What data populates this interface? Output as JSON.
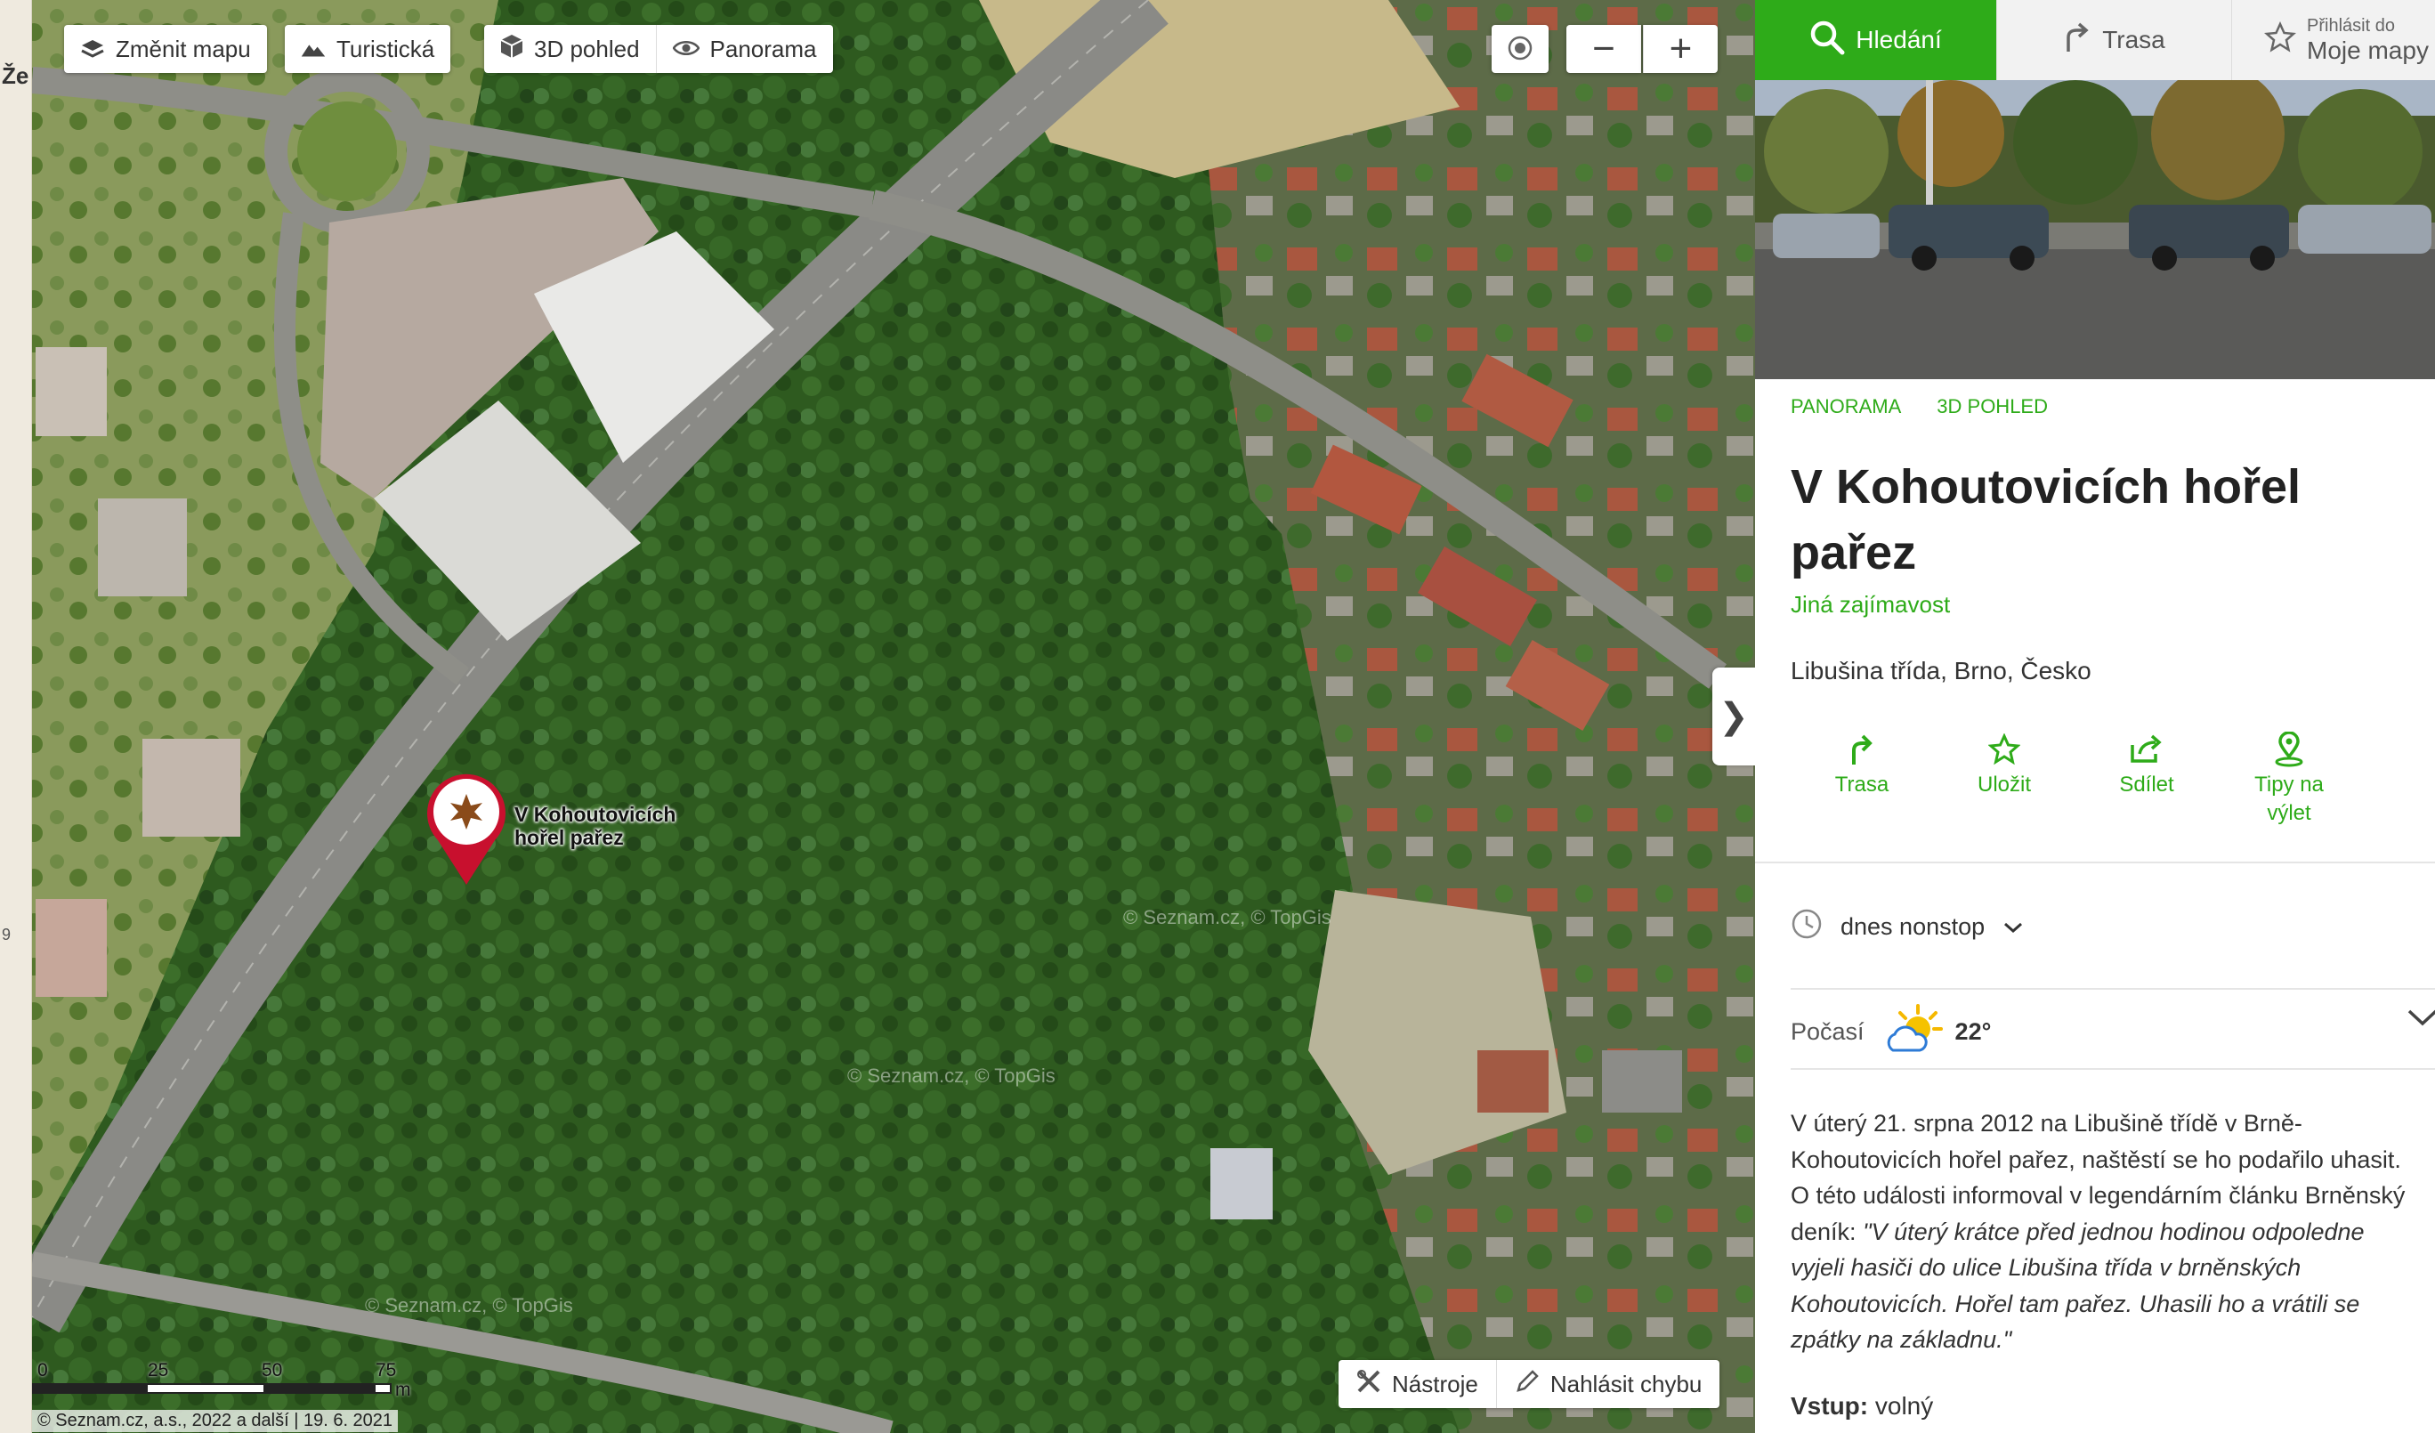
{
  "map": {
    "change_map_label": "Změnit mapu",
    "layer_buttons": {
      "turisticka": "Turistická",
      "pohled3d": "3D pohled",
      "panorama": "Panorama"
    },
    "poi_label_line1": "V Kohoutovicích",
    "poi_label_line2": "hořel pařez",
    "poi_icon": "fire-star-icon",
    "watermark_1": "© Seznam.cz, © TopGis",
    "watermark_2": "© Seznam.cz, © TopGis",
    "watermark_3": "© Seznam.cz, © TopGis",
    "scale_ticks": [
      "0",
      "25",
      "50",
      "75"
    ],
    "scale_unit": "m",
    "copyright": "© Seznam.cz, a.s., 2022 a další | 19. 6. 2021",
    "tools_label": "Nástroje",
    "report_label": "Nahlásit chybu",
    "left_strip_text": [
      "Že",
      "9"
    ],
    "zoom_minus": "−",
    "zoom_plus": "+",
    "collapse_arrow": "❯"
  },
  "panel": {
    "tabs": {
      "search": "Hledání",
      "route": "Trasa",
      "login_small": "Přihlásit do",
      "login_big": "Moje mapy"
    },
    "links": [
      "PANORAMA",
      "3D POHLED"
    ],
    "title": "V Kohoutovicích hořel pařez",
    "category": "Jiná zajímavost",
    "address": "Libušina třída, Brno, Česko",
    "actions": {
      "route": "Trasa",
      "save": "Uložit",
      "share": "Sdílet",
      "tips": "Tipy na výlet"
    },
    "hours": "dnes nonstop",
    "weather_label": "Počasí",
    "weather_temp": "22°",
    "description_plain": "V úterý 21. srpna 2012 na Libušině třídě v Brně-Kohoutovicích hořel pařez, naštěstí se ho podařilo uhasit. O této události informoval v legendárním článku Brněnský deník: ",
    "description_quote": "\"V úterý krátce před jednou hodinou odpoledne vyjeli hasiči do ulice Libušina třída v brněnských Kohoutovicích. Hořel tam pařez. Uhasili ho a vrátili se zpátky na základnu.\"",
    "entry_label": "Vstup:",
    "entry_value": "volný"
  },
  "colors": {
    "accent": "#2eab19",
    "pin": "#c8102e"
  }
}
